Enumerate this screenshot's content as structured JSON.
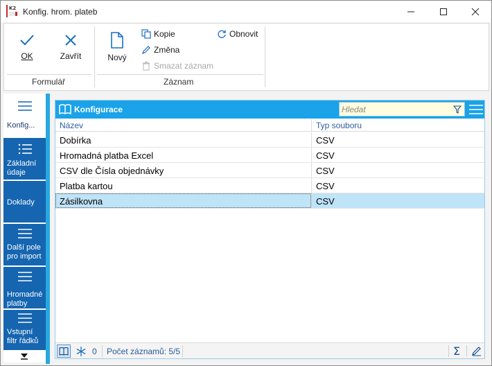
{
  "window": {
    "title": "Konfig. hrom. plateb",
    "minimize_glyph": "—",
    "maximize_glyph": "☐",
    "close_glyph": "✕"
  },
  "ribbon": {
    "formular": {
      "group_label": "Formulář",
      "ok_label": "OK",
      "close_label": "Zavřít"
    },
    "zaznam": {
      "group_label": "Záznam",
      "new_label": "Nový",
      "copy_label": "Kopie",
      "edit_label": "Změna",
      "delete_label": "Smazat záznam",
      "refresh_label": "Obnovit"
    }
  },
  "nav": {
    "items": [
      {
        "label": "Konfig...",
        "active": true
      },
      {
        "label": "Základní údaje"
      },
      {
        "label": "Doklady"
      },
      {
        "label": "Další pole pro import"
      },
      {
        "label": "Hromadné platby"
      },
      {
        "label": "Vstupní filtr řádků"
      }
    ]
  },
  "panel": {
    "title": "Konfigurace",
    "search_placeholder": "Hledat",
    "columns": [
      "Název",
      "Typ souboru"
    ],
    "rows": [
      {
        "name": "Dobírka",
        "type": "CSV"
      },
      {
        "name": "Hromadná platba Excel",
        "type": "CSV"
      },
      {
        "name": "CSV dle Čísla objednávky",
        "type": "CSV"
      },
      {
        "name": "Platba kartou",
        "type": "CSV"
      },
      {
        "name": "Zásilkovna",
        "type": "CSV",
        "selected": true
      }
    ],
    "status": {
      "marked_count": "0",
      "record_count": "Počet záznamů: 5/5"
    }
  },
  "colors": {
    "accent": "#1aa3e8",
    "nav_bg": "#1565b0",
    "selected_row": "#bfe3f7",
    "search_bg": "#fffde0"
  }
}
